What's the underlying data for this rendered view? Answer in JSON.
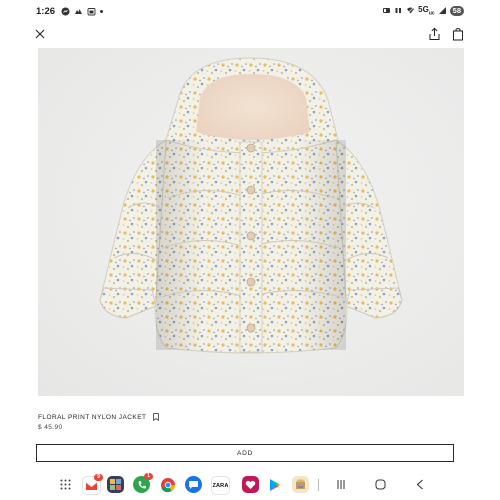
{
  "status_bar": {
    "time": "1:26",
    "network": "5G",
    "network_sub": "uc",
    "battery": "58",
    "icons": [
      "messenger-icon",
      "cloud-icon",
      "calendar-icon",
      "dot-icon",
      "alarm-icon",
      "mute-icon",
      "wifi-off-icon",
      "signal-icon"
    ]
  },
  "top_bar": {
    "icons": [
      "close-icon",
      "share-icon",
      "shopping-bag-icon"
    ]
  },
  "product": {
    "name": "FLORAL PRINT NYLON JACKET",
    "price": "$ 45.90",
    "image_alt": "floral-print-quilted-hooded-baby-jacket"
  },
  "add_button": {
    "label": "ADD"
  },
  "taskbar": {
    "apps": [
      {
        "name": "gmail",
        "label": "M",
        "color": "#ffffff",
        "badge": "9"
      },
      {
        "name": "gallery",
        "label": "",
        "color": "#3a3f55",
        "badge": ""
      },
      {
        "name": "phone",
        "label": "",
        "color": "#2ea44f",
        "badge": "1"
      },
      {
        "name": "chrome",
        "label": "",
        "color": "#ffffff",
        "badge": ""
      },
      {
        "name": "messages",
        "label": "",
        "color": "#1a73e8",
        "badge": ""
      },
      {
        "name": "zara",
        "label": "ZARA",
        "color": "#ffffff",
        "badge": ""
      },
      {
        "name": "heart-app",
        "label": "",
        "color": "#c2185b",
        "badge": ""
      },
      {
        "name": "play-store",
        "label": "",
        "color": "#ffffff",
        "badge": ""
      },
      {
        "name": "amazon",
        "label": "",
        "color": "#f3e5c8",
        "badge": ""
      }
    ]
  },
  "colors": {
    "accent": "#222222",
    "image_bg": "#ececeb",
    "jacket_base": "#f4f1e8",
    "floral_yellow": "#e8c069",
    "floral_blue": "#8aa0bd"
  }
}
